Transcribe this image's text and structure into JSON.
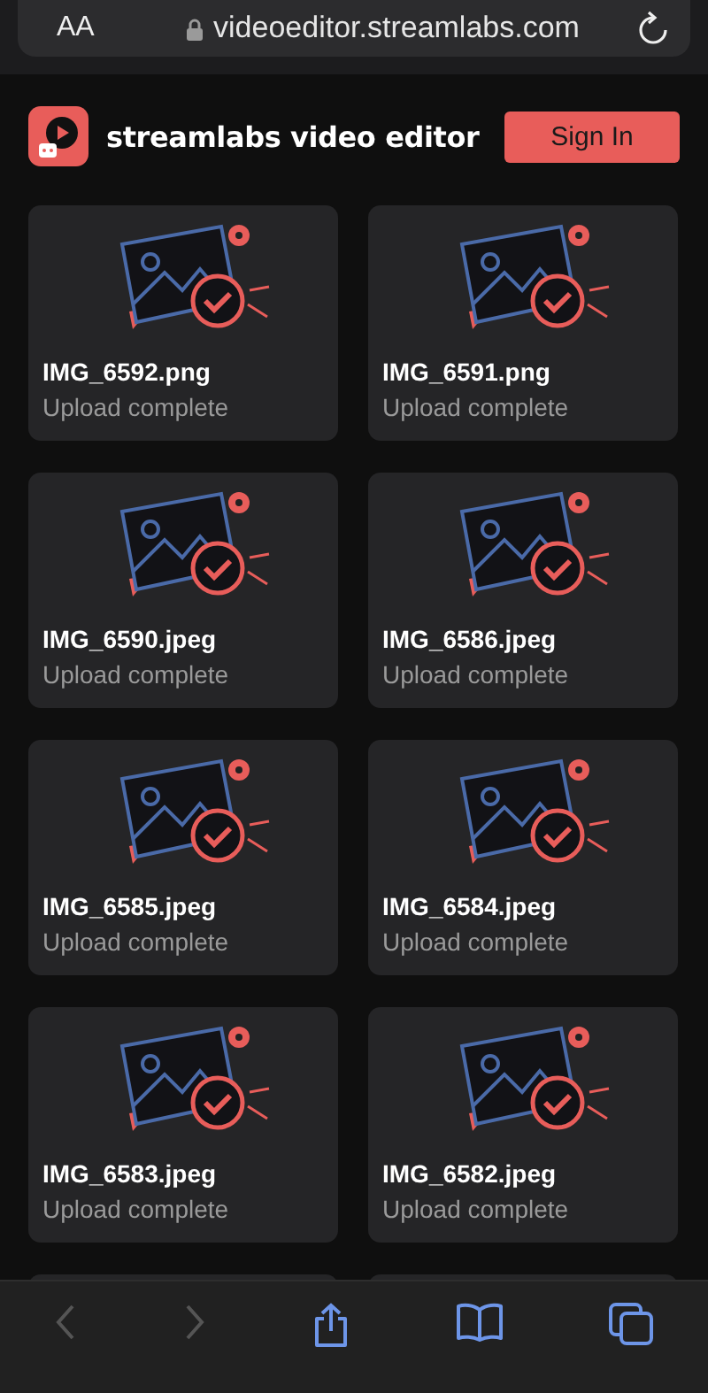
{
  "browser": {
    "text_size_button": "AA",
    "url": "videoeditor.streamlabs.com"
  },
  "header": {
    "title": "streamlabs video editor",
    "sign_in": "Sign In"
  },
  "files": [
    {
      "name": "IMG_6592.png",
      "status": "Upload complete"
    },
    {
      "name": "IMG_6591.png",
      "status": "Upload complete"
    },
    {
      "name": "IMG_6590.jpeg",
      "status": "Upload complete"
    },
    {
      "name": "IMG_6586.jpeg",
      "status": "Upload complete"
    },
    {
      "name": "IMG_6585.jpeg",
      "status": "Upload complete"
    },
    {
      "name": "IMG_6584.jpeg",
      "status": "Upload complete"
    },
    {
      "name": "IMG_6583.jpeg",
      "status": "Upload complete"
    },
    {
      "name": "IMG_6582.jpeg",
      "status": "Upload complete"
    }
  ],
  "toolbar": [
    {
      "kind": "back",
      "disabled": true
    },
    {
      "kind": "forward",
      "disabled": true
    },
    {
      "kind": "share",
      "disabled": false
    },
    {
      "kind": "bookmarks",
      "disabled": false
    },
    {
      "kind": "tabs",
      "disabled": false
    }
  ]
}
